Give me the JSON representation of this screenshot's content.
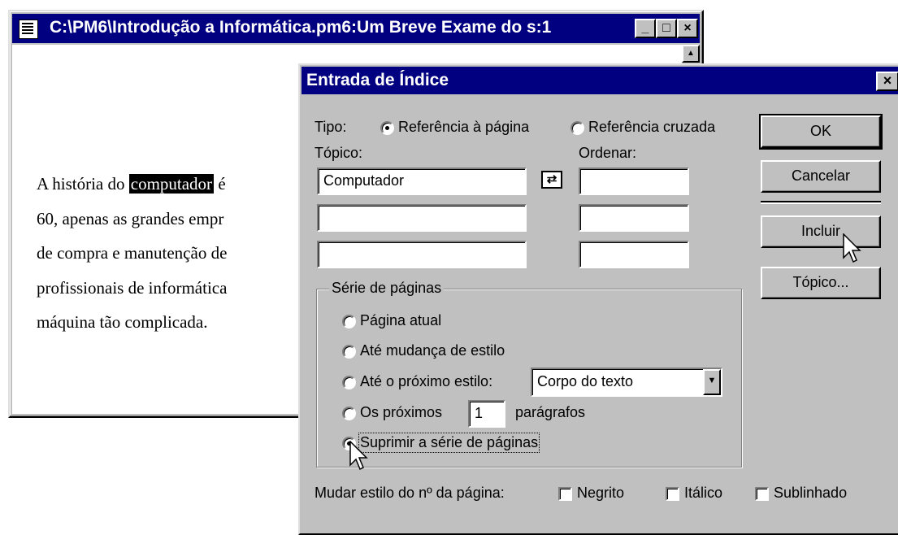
{
  "doc_window": {
    "title": "C:\\PM6\\Introdução a Informática.pm6:Um Breve Exame do s:1",
    "minimize": "_",
    "maximize": "□",
    "close": "×",
    "scroll_up": "▲",
    "lines": [
      {
        "before": "A história do ",
        "highlight": "computador",
        "after": " é"
      },
      {
        "text": "60, apenas as grandes empr"
      },
      {
        "text": "de compra e manutenção de"
      },
      {
        "text": "profissionais de informática"
      },
      {
        "text": "máquina tão complicada."
      }
    ]
  },
  "dialog": {
    "title": "Entrada de Índice",
    "close": "×",
    "tipo_label": "Tipo:",
    "tipo_options": [
      "Referência à página",
      "Referência cruzada"
    ],
    "tipo_selected": 0,
    "topico_label": "Tópico:",
    "ordenar_label": "Ordenar:",
    "topico_fields": [
      "Computador",
      "",
      ""
    ],
    "ordenar_fields": [
      "",
      "",
      ""
    ],
    "swap_icon": "⇄",
    "buttons": {
      "ok": "OK",
      "cancel": "Cancelar",
      "include": "Incluir",
      "topic": "Tópico..."
    },
    "page_range_group": "Série de páginas",
    "page_range_options": {
      "current": "Página atual",
      "style_change": "Até mudança de estilo",
      "next_style": "Até o próximo estilo:",
      "next_paragraphs": "Os próximos",
      "paragraphs_suffix": "parágrafos",
      "suppress": "Suprimir a série de páginas"
    },
    "page_range_selected": "suppress",
    "next_style_value": "Corpo do texto",
    "paragraph_count": "1",
    "page_num_style_label": "Mudar estilo do nº da página:",
    "style_checks": [
      "Negrito",
      "Itálico",
      "Sublinhado"
    ]
  }
}
